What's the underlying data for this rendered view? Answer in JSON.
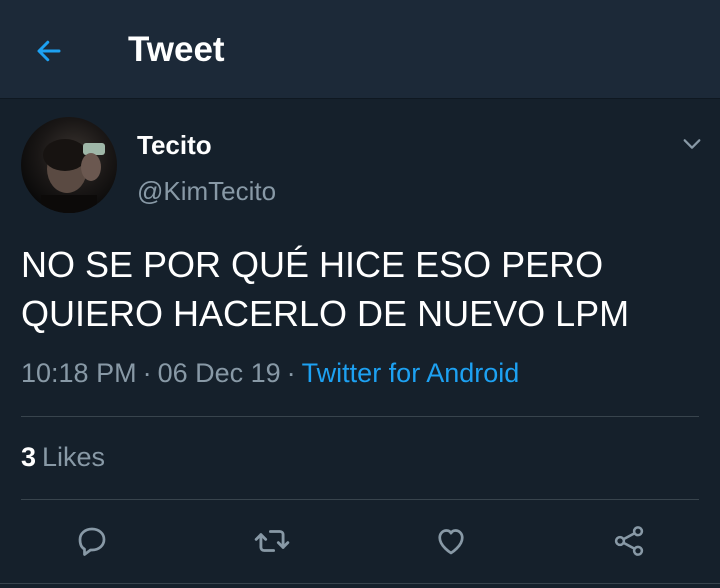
{
  "header": {
    "title": "Tweet",
    "back_icon": "arrow-left-icon"
  },
  "tweet": {
    "author_name": "Tecito",
    "author_handle": "@KimTecito",
    "text": "NO SE POR QUÉ HICE ESO PERO\nQUIERO HACERLO DE NUEVO LPM",
    "time": "10:18 PM",
    "date": "06 Dec 19",
    "separator": "·",
    "source": "Twitter for Android",
    "likes_count": "3",
    "likes_label": "Likes"
  },
  "actions": [
    {
      "icon": "reply-icon"
    },
    {
      "icon": "retweet-icon"
    },
    {
      "icon": "like-icon"
    },
    {
      "icon": "share-icon"
    }
  ],
  "colors": {
    "background": "#15202b",
    "header": "#1c2938",
    "accent": "#1da1f2",
    "muted": "#8899a6",
    "divider": "#38444d"
  }
}
